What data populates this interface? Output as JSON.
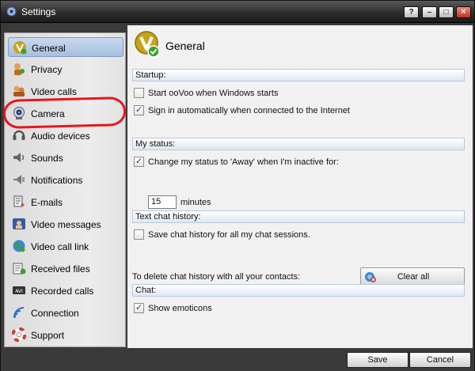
{
  "window": {
    "title": "Settings"
  },
  "titlebar": {
    "help": "?",
    "minimize": "–",
    "maximize": "□",
    "close": "✕"
  },
  "sidebar": {
    "items": [
      {
        "label": "General",
        "icon": "general-icon",
        "active": true
      },
      {
        "label": "Privacy",
        "icon": "privacy-icon"
      },
      {
        "label": "Video calls",
        "icon": "video-calls-icon"
      },
      {
        "label": "Camera",
        "icon": "camera-icon"
      },
      {
        "label": "Audio devices",
        "icon": "audio-devices-icon"
      },
      {
        "label": "Sounds",
        "icon": "sounds-icon"
      },
      {
        "label": "Notifications",
        "icon": "notifications-icon"
      },
      {
        "label": "E-mails",
        "icon": "emails-icon"
      },
      {
        "label": "Video messages",
        "icon": "video-messages-icon"
      },
      {
        "label": "Video call link",
        "icon": "video-call-link-icon"
      },
      {
        "label": "Received files",
        "icon": "received-files-icon"
      },
      {
        "label": "Recorded calls",
        "icon": "recorded-calls-icon"
      },
      {
        "label": "Connection",
        "icon": "connection-icon"
      },
      {
        "label": "Support",
        "icon": "support-icon"
      }
    ]
  },
  "main": {
    "title": "General",
    "startup": {
      "header": "Startup:",
      "start_on_windows": {
        "label": "Start ooVoo when Windows starts",
        "checked": false
      },
      "auto_sign_in": {
        "label": "Sign in automatically when connected to the Internet",
        "checked": true
      }
    },
    "status": {
      "header": "My status:",
      "away_when_inactive": {
        "label": "Change my status to 'Away' when I'm inactive for:",
        "checked": true
      },
      "minutes_value": "15",
      "minutes_label": "minutes"
    },
    "chat_history": {
      "header": "Text chat history:",
      "save_history": {
        "label": "Save chat history for all my chat sessions.",
        "checked": false
      },
      "delete_text": "To delete chat history with all your contacts:",
      "clear_all_label": "Clear all"
    },
    "chat": {
      "header": "Chat:",
      "show_emoticons": {
        "label": "Show emoticons",
        "checked": true
      }
    }
  },
  "footer": {
    "save_label": "Save",
    "cancel_label": "Cancel"
  },
  "colors": {
    "highlight_ring": "#e8161b",
    "active_item": "#b8cce6",
    "brand_yellow": "#c8a21a",
    "brand_green": "#3aa231"
  }
}
